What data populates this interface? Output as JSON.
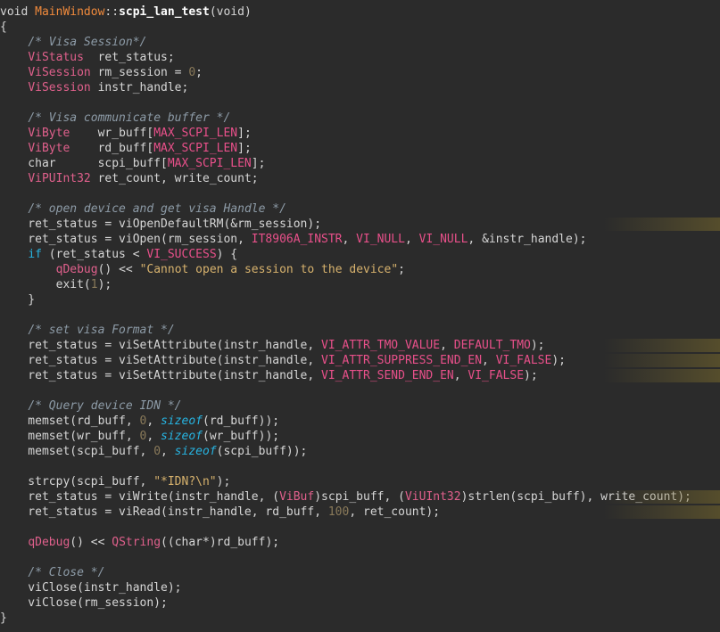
{
  "editor": {
    "language": "C++",
    "theme_bg": "#2b2b2b",
    "colors": {
      "type": "#e0608c",
      "function_def": "#f08a3c",
      "comment": "#8d9ba7",
      "string": "#d7b26d",
      "number": "#8a7a5a",
      "keyword_blue": "#27b3e0"
    },
    "lines": [
      "void MainWindow::scpi_lan_test(void)",
      "{",
      "    /* Visa Session*/",
      "    ViStatus  ret_status;",
      "    ViSession rm_session = 0;",
      "    ViSession instr_handle;",
      "",
      "    /* Visa communicate buffer */",
      "    ViByte    wr_buff[MAX_SCPI_LEN];",
      "    ViByte    rd_buff[MAX_SCPI_LEN];",
      "    char      scpi_buff[MAX_SCPI_LEN];",
      "    ViPUInt32 ret_count, write_count;",
      "",
      "    /* open device and get visa Handle */",
      "    ret_status = viOpenDefaultRM(&rm_session);",
      "    ret_status = viOpen(rm_session, IT8906A_INSTR, VI_NULL, VI_NULL, &instr_handle);",
      "    if (ret_status < VI_SUCCESS) {",
      "        qDebug() << \"Cannot open a session to the device\";",
      "        exit(1);",
      "    }",
      "",
      "    /* set visa Format */",
      "    ret_status = viSetAttribute(instr_handle, VI_ATTR_TMO_VALUE, DEFAULT_TMO);",
      "    ret_status = viSetAttribute(instr_handle, VI_ATTR_SUPPRESS_END_EN, VI_FALSE);",
      "    ret_status = viSetAttribute(instr_handle, VI_ATTR_SEND_END_EN, VI_FALSE);",
      "",
      "    /* Query device IDN */",
      "    memset(rd_buff, 0, sizeof(rd_buff));",
      "    memset(wr_buff, 0, sizeof(wr_buff));",
      "    memset(scpi_buff, 0, sizeof(scpi_buff));",
      "",
      "    strcpy(scpi_buff, \"*IDN?\\n\");",
      "    ret_status = viWrite(instr_handle, (ViBuf)scpi_buff, (ViUInt32)strlen(scpi_buff), write_count);",
      "    ret_status = viRead(instr_handle, rd_buff, 100, ret_count);",
      "",
      "    qDebug() << QString((char*)rd_buff);",
      "",
      "    /* Close */",
      "    viClose(instr_handle);",
      "    viClose(rm_session);",
      "}"
    ],
    "highlighted_lines": [
      14,
      22,
      23,
      24,
      32,
      33
    ]
  }
}
